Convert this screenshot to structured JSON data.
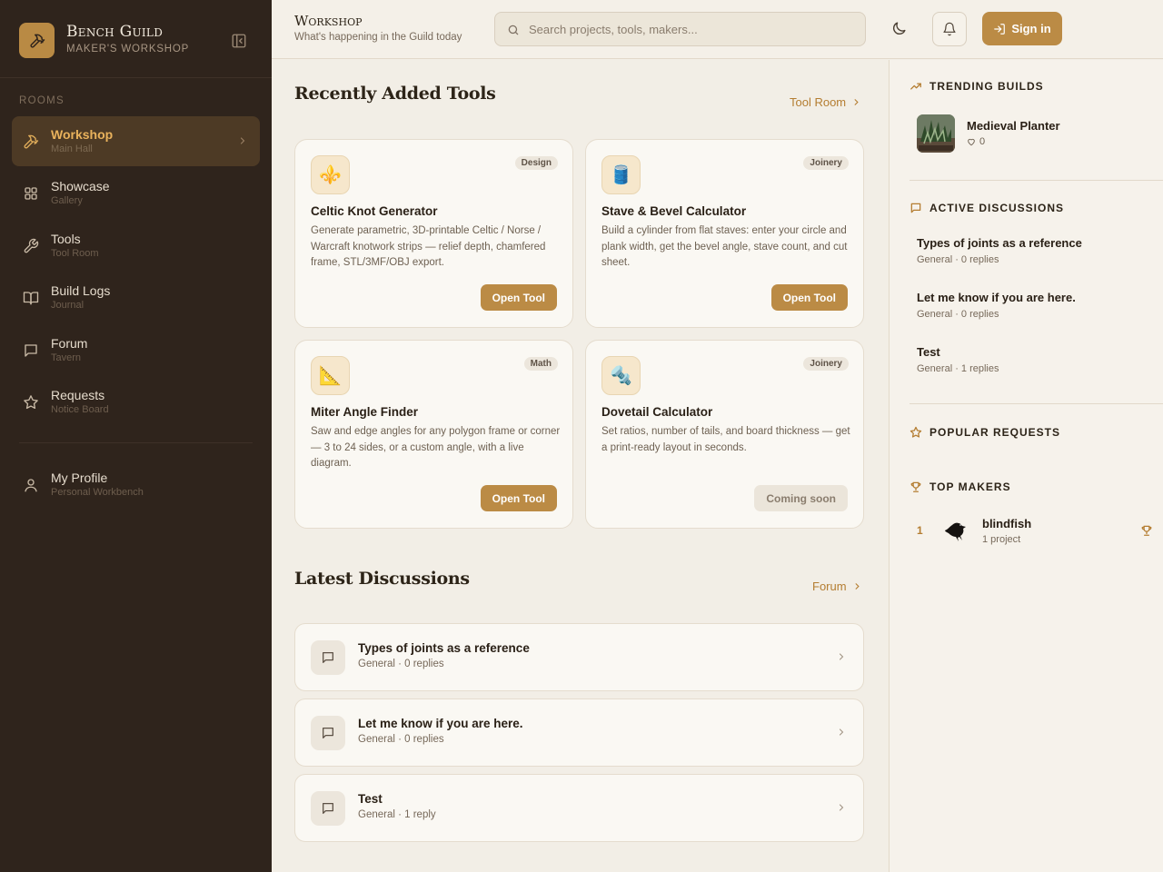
{
  "app": {
    "name": "Bench Guild",
    "tagline": "MAKER'S WORKSHOP"
  },
  "sidebar": {
    "section_label": "ROOMS",
    "items": [
      {
        "label": "Workshop",
        "sub": "Main Hall",
        "icon": "hammer-icon",
        "active": true
      },
      {
        "label": "Showcase",
        "sub": "Gallery",
        "icon": "grid-icon"
      },
      {
        "label": "Tools",
        "sub": "Tool Room",
        "icon": "wrench-icon"
      },
      {
        "label": "Build Logs",
        "sub": "Journal",
        "icon": "book-icon"
      },
      {
        "label": "Forum",
        "sub": "Tavern",
        "icon": "chat-icon"
      },
      {
        "label": "Requests",
        "sub": "Notice Board",
        "icon": "star-icon"
      }
    ],
    "profile": {
      "label": "My Profile",
      "sub": "Personal Workbench",
      "icon": "user-icon"
    }
  },
  "header": {
    "title": "Workshop",
    "subtitle": "What's happening in the Guild today",
    "search_placeholder": "Search projects, tools, makers...",
    "signin_label": "Sign in"
  },
  "tools_section": {
    "title": "Recently Added Tools",
    "link_label": "Tool Room",
    "tools": [
      {
        "name": "Celtic Knot Generator",
        "tag": "Design",
        "icon": "⚜️",
        "description": "Generate parametric, 3D-printable Celtic / Norse / Warcraft knotwork strips — relief depth, chamfered frame, STL/3MF/OBJ export.",
        "button": "Open Tool"
      },
      {
        "name": "Stave & Bevel Calculator",
        "tag": "Joinery",
        "icon": "🛢️",
        "description": "Build a cylinder from flat staves: enter your circle and plank width, get the bevel angle, stave count, and cut sheet.",
        "button": "Open Tool"
      },
      {
        "name": "Miter Angle Finder",
        "tag": "Math",
        "icon": "📐",
        "description": "Saw and edge angles for any polygon frame or corner — 3 to 24 sides, or a custom angle, with a live diagram.",
        "button": "Open Tool"
      },
      {
        "name": "Dovetail Calculator",
        "tag": "Joinery",
        "icon": "🔩",
        "description": "Set ratios, number of tails, and board thickness — get a print-ready layout in seconds.",
        "button": "Coming soon"
      }
    ]
  },
  "discussions_section": {
    "title": "Latest Discussions",
    "link_label": "Forum",
    "items": [
      {
        "title": "Types of joints as a reference",
        "meta": "General · 0 replies"
      },
      {
        "title": "Let me know if you are here.",
        "meta": "General · 0 replies"
      },
      {
        "title": "Test",
        "meta": "General · 1 reply"
      }
    ]
  },
  "right_panel": {
    "trending": {
      "heading": "TRENDING BUILDS",
      "items": [
        {
          "name": "Medieval Planter",
          "likes": "0"
        }
      ]
    },
    "active_discussions": {
      "heading": "ACTIVE DISCUSSIONS",
      "items": [
        {
          "title": "Types of joints as a reference",
          "meta": "General · 0 replies"
        },
        {
          "title": "Let me know if you are here.",
          "meta": "General · 0 replies"
        },
        {
          "title": "Test",
          "meta": "General · 1 replies"
        }
      ]
    },
    "popular_requests": {
      "heading": "POPULAR REQUESTS"
    },
    "top_makers": {
      "heading": "TOP MAKERS",
      "items": [
        {
          "rank": "1",
          "name": "blindfish",
          "sub": "1 project"
        }
      ]
    }
  },
  "colors": {
    "accent": "#bb8b45",
    "sidebar_bg": "#2f241c",
    "page_bg": "#f2eee6"
  }
}
